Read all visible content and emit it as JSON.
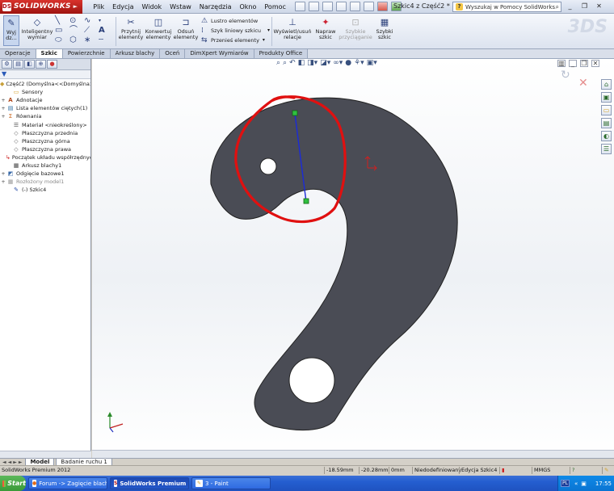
{
  "app": {
    "name": "SOLIDWORKS",
    "document_title": "Szkic4 z Część2 *",
    "menu": [
      "Plik",
      "Edycja",
      "Widok",
      "Wstaw",
      "Narzędzia",
      "Okno",
      "Pomoc"
    ],
    "help_search_placeholder": "Wyszukaj w Pomocy SolidWorks"
  },
  "command_manager": {
    "exit_sketch": "Wyj dz...",
    "smart_dimension": [
      "Inteligentny",
      "wymiar"
    ],
    "trim_entities": [
      "Przytnij",
      "elementy"
    ],
    "convert_entities": [
      "Konwertuj",
      "elementy"
    ],
    "offset_entities": [
      "Odsuń",
      "elementy"
    ],
    "mirror_entities": "Lustro elementów",
    "linear_pattern": "Szyk liniowy szkicu",
    "move_entities": "Przenieś elementy",
    "display_relations": [
      "Wyświetl/usuń",
      "relacje"
    ],
    "repair_sketch": [
      "Napraw",
      "szkic"
    ],
    "quick_snaps": [
      "Szybkie",
      "przyciąganie"
    ],
    "rapid_sketch": [
      "Szybki",
      "szkic"
    ]
  },
  "tabs": [
    "Operacje",
    "Szkic",
    "Powierzchnie",
    "Arkusz blachy",
    "Oceń",
    "DimXpert Wymiarów",
    "Produkty Office"
  ],
  "active_tab": "Szkic",
  "feature_tree": [
    {
      "label": "Część2  (Domyślna<<Domyślna>_",
      "icon": "part-icon",
      "expand": ""
    },
    {
      "label": "Sensory",
      "icon": "folder-icon",
      "expand": ""
    },
    {
      "label": "Adnotacje",
      "icon": "annotation-icon",
      "expand": "+"
    },
    {
      "label": "Lista elementów ciętych(1)",
      "icon": "cutlist-icon",
      "expand": "+"
    },
    {
      "label": "Równania",
      "icon": "equation-icon",
      "expand": "+"
    },
    {
      "label": "Materiał <nieokreślony>",
      "icon": "material-icon",
      "expand": ""
    },
    {
      "label": "Płaszczyzna przednia",
      "icon": "plane-icon",
      "expand": ""
    },
    {
      "label": "Płaszczyzna górna",
      "icon": "plane-icon",
      "expand": ""
    },
    {
      "label": "Płaszczyzna prawa",
      "icon": "plane-icon",
      "expand": ""
    },
    {
      "label": "Początek układu współrzędnyc",
      "icon": "origin-icon",
      "expand": ""
    },
    {
      "label": "Arkusz blachy1",
      "icon": "sheetmetal-icon",
      "expand": ""
    },
    {
      "label": "Odgięcie bazowe1",
      "icon": "baseflange-icon",
      "expand": "+"
    },
    {
      "label": "Rozłożony model1",
      "icon": "flatpattern-icon",
      "expand": "+",
      "dim": true
    },
    {
      "label": "(-) Szkic4",
      "icon": "sketch-icon",
      "expand": ""
    }
  ],
  "bottom_tabs": [
    "Model",
    "Badanie ruchu 1"
  ],
  "status": {
    "product": "SolidWorks Premium 2012",
    "x": "-18.59mm",
    "y": "-20.28mm",
    "z": "0mm",
    "definition": "Niedodefiniowany",
    "mode": "Edycja Szkic4",
    "units": "MMGS"
  },
  "taskbar": {
    "start": "Start",
    "tasks": [
      "Forum -> Zagięcie blach...",
      "SolidWorks Premium ...",
      "3 - Paint"
    ],
    "active_task": 1,
    "lang": "PL",
    "clock": "17:55"
  }
}
